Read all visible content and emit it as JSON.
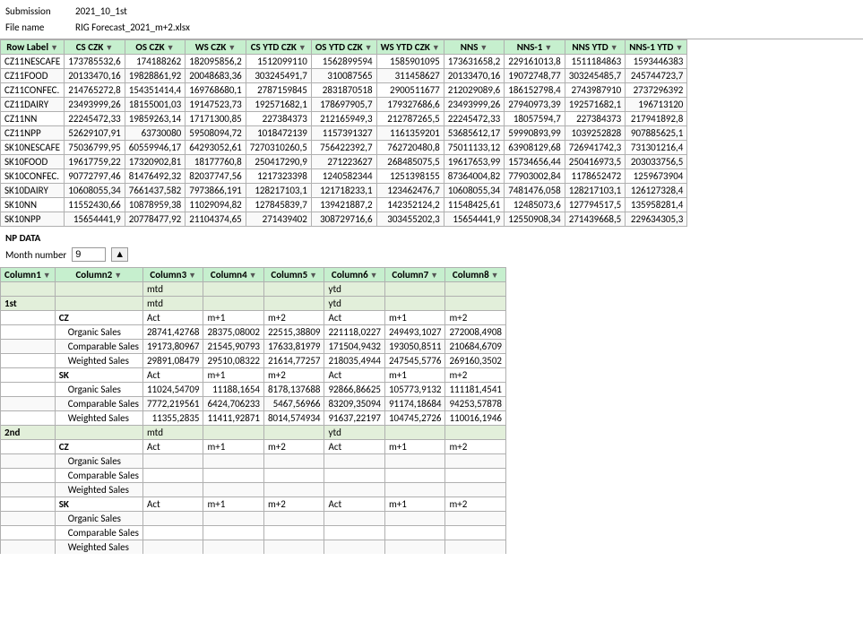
{
  "meta": {
    "submission_label": "Submission",
    "submission_value": "2021_10_1st",
    "filename_label": "File name",
    "filename_value": "RIG Forecast_2021_m+2.xlsx"
  },
  "upper_table": {
    "headers": [
      "Row Label",
      "CS CZK",
      "OS CZK",
      "WS CZK",
      "CS YTD CZK",
      "OS YTD CZK",
      "WS YTD CZK",
      "NNS",
      "NNS-1",
      "NNS YTD",
      "NNS-1 YTD"
    ],
    "rows": [
      [
        "CZ11NESCAFE",
        "173785532,6",
        "174188262",
        "182095856,2",
        "1512099110",
        "1562899594",
        "1585901095",
        "173631658,2",
        "229161013,8",
        "1511184863",
        "1593446383"
      ],
      [
        "CZ11FOOD",
        "20133470,16",
        "19828861,92",
        "20048683,36",
        "303245491,7",
        "310087565",
        "311458627",
        "20133470,16",
        "19072748,77",
        "303245485,7",
        "245744723,7"
      ],
      [
        "CZ11CONFEC.",
        "214765272,8",
        "154351414,4",
        "169768680,1",
        "2787159845",
        "2831870518",
        "2900511677",
        "212029089,6",
        "186152798,4",
        "2743987910",
        "2737296392"
      ],
      [
        "CZ11DAIRY",
        "23493999,26",
        "18155001,03",
        "19147523,73",
        "192571682,1",
        "178697905,7",
        "179327686,6",
        "23493999,26",
        "27940973,39",
        "192571682,1",
        "196713120"
      ],
      [
        "CZ11NN",
        "22245472,33",
        "19859263,14",
        "17171300,85",
        "227384373",
        "212165949,3",
        "212787265,5",
        "22245472,33",
        "18057594,7",
        "227384373",
        "217941892,8"
      ],
      [
        "CZ11NPP",
        "52629107,91",
        "63730080",
        "59508094,72",
        "1018472139",
        "1157391327",
        "1161359201",
        "53685612,17",
        "59990893,99",
        "1039252828",
        "907885625,1"
      ],
      [
        "SK10NESCAFE",
        "75036799,95",
        "60559946,17",
        "64293052,61",
        "7270310260,5",
        "756422392,7",
        "762720480,8",
        "75011133,12",
        "63908129,68",
        "726941742,3",
        "731301216,4"
      ],
      [
        "SK10FOOD",
        "19617759,22",
        "17320902,81",
        "18177760,8",
        "250417290,9",
        "271223627",
        "268485075,5",
        "19617653,99",
        "15734656,44",
        "250416973,5",
        "203033756,5"
      ],
      [
        "SK10CONFEC.",
        "90772797,46",
        "81476492,32",
        "82037747,56",
        "1217323398",
        "1240582344",
        "1251398155",
        "87364004,82",
        "77903002,84",
        "1178652472",
        "1259673904"
      ],
      [
        "SK10DAIRY",
        "10608055,34",
        "7661437,582",
        "7973866,191",
        "128217103,1",
        "121718233,1",
        "123462476,7",
        "10608055,34",
        "7481476,058",
        "128217103,1",
        "126127328,4"
      ],
      [
        "SK10NN",
        "11552430,66",
        "10878959,38",
        "11029094,82",
        "127845839,7",
        "139421887,2",
        "142352124,2",
        "11548425,61",
        "12485073,6",
        "127794517,5",
        "135958281,4"
      ],
      [
        "SK10NPP",
        "15654441,9",
        "20778477,92",
        "21104374,65",
        "271439402",
        "308729716,6",
        "303455202,3",
        "15654441,9",
        "12550908,34",
        "271439668,5",
        "229634305,3"
      ]
    ]
  },
  "np_section": {
    "title": "NP DATA",
    "month_label": "Month number",
    "month_value": "9"
  },
  "lower_table": {
    "headers": [
      "Column1",
      "Column2",
      "Column3",
      "Column4",
      "Column5",
      "Column6",
      "Column7",
      "Column8"
    ],
    "subheaders1": [
      "",
      "",
      "mtd",
      "",
      "",
      "ytd",
      "",
      ""
    ],
    "subheaders2": [
      "",
      "",
      "Act",
      "m+1",
      "m+2",
      "Act",
      "m+1",
      "m+2"
    ],
    "sections": [
      {
        "id": "1st",
        "label": "1st",
        "groups": [
          {
            "label": "CZ",
            "subheader": [
              "",
              "Act",
              "m+1",
              "m+2",
              "Act",
              "m+1",
              "m+2"
            ],
            "rows": [
              {
                "name": "Organic Sales",
                "values": [
                  "28741,42768",
                  "28375,08002",
                  "22515,38809",
                  "221118,0227",
                  "249493,1027",
                  "272008,4908"
                ]
              },
              {
                "name": "Comparable Sales",
                "values": [
                  "19173,80967",
                  "21545,90793",
                  "17633,81979",
                  "171504,9432",
                  "193050,8511",
                  "210684,6709"
                ]
              },
              {
                "name": "Weighted Sales",
                "values": [
                  "29891,08479",
                  "29510,08322",
                  "21614,77257",
                  "218035,4944",
                  "247545,5776",
                  "269160,3502"
                ]
              }
            ]
          },
          {
            "label": "SK",
            "subheader": [
              "",
              "Act",
              "m+1",
              "m+2",
              "Act",
              "m+1",
              "m+2"
            ],
            "rows": [
              {
                "name": "Organic Sales",
                "values": [
                  "11024,54709",
                  "11188,1654",
                  "8178,137688",
                  "92866,86625",
                  "105773,9132",
                  "111181,4541"
                ]
              },
              {
                "name": "Comparable Sales",
                "values": [
                  "7772,219561",
                  "6424,706233",
                  "5467,56966",
                  "83209,35094",
                  "91174,18684",
                  "94253,57878"
                ]
              },
              {
                "name": "Weighted Sales",
                "values": [
                  "11355,2835",
                  "11411,92871",
                  "8014,574934",
                  "91637,22197",
                  "104745,2726",
                  "110016,1946"
                ]
              }
            ]
          }
        ]
      },
      {
        "id": "2nd",
        "label": "2nd",
        "groups": [
          {
            "label": "CZ",
            "subheader": [
              "",
              "Act",
              "m+1",
              "m+2",
              "Act",
              "m+1",
              "m+2"
            ],
            "rows": [
              {
                "name": "Organic Sales",
                "values": [
                  "",
                  "",
                  "",
                  "",
                  "",
                  ""
                ]
              },
              {
                "name": "Comparable Sales",
                "values": [
                  "",
                  "",
                  "",
                  "",
                  "",
                  ""
                ]
              },
              {
                "name": "Weighted Sales",
                "values": [
                  "",
                  "",
                  "",
                  "",
                  "",
                  ""
                ]
              }
            ]
          },
          {
            "label": "SK",
            "subheader": [
              "",
              "Act",
              "m+1",
              "m+2",
              "Act",
              "m+1",
              "m+2"
            ],
            "rows": [
              {
                "name": "Organic Sales",
                "values": [
                  "",
                  "",
                  "",
                  "",
                  "",
                  ""
                ]
              },
              {
                "name": "Comparable Sales",
                "values": [
                  "",
                  "",
                  "",
                  "",
                  "",
                  ""
                ]
              },
              {
                "name": "Weighted Sales",
                "values": [
                  "",
                  "",
                  "",
                  "",
                  "",
                  ""
                ]
              }
            ]
          }
        ]
      }
    ]
  }
}
